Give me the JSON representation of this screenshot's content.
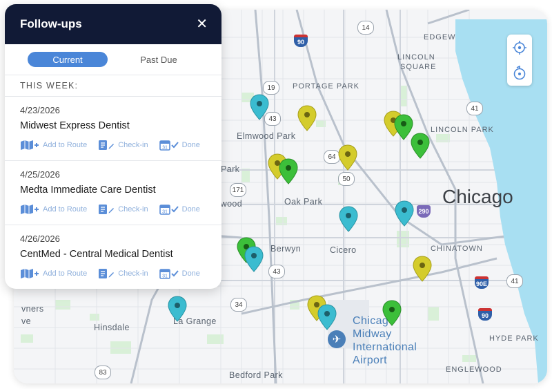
{
  "panel": {
    "title": "Follow-ups",
    "tabs": [
      {
        "label": "Current",
        "active": true
      },
      {
        "label": "Past Due",
        "active": false
      }
    ],
    "section_title": "THIS WEEK:",
    "items": [
      {
        "date": "4/23/2026",
        "name": "Midwest Express Dentist"
      },
      {
        "date": "4/25/2026",
        "name": "Medta Immediate Care Dentist"
      },
      {
        "date": "4/26/2026",
        "name": "CentMed - Central Medical Dentist"
      }
    ],
    "actions": {
      "add_to_route": "Add to Route",
      "check_in": "Check-in",
      "done": "Done"
    }
  },
  "map": {
    "labels": {
      "edgewater": "EDGEW",
      "lincoln_square_1": "LINCOLN",
      "lincoln_square_2": "SQUARE",
      "portage_park": "PORTAGE PARK",
      "elmwood_park": "Elmwood Park",
      "lincoln_park": "LINCOLN PARK",
      "park": "Park",
      "ywood": "ywood",
      "oak_park": "Oak Park",
      "chicago": "Chicago",
      "berwyn": "Berwyn",
      "cicero": "Cicero",
      "chinatown": "CHINATOWN",
      "vners": "vners",
      "ve": "ve",
      "hinsdale": "Hinsdale",
      "la_grange": "La Grange",
      "airport": "Chicago Midway International Airport",
      "hyde_park": "HYDE PARK",
      "englewood": "ENGLEWOOD",
      "bedford_park": "Bedford Park"
    },
    "highways": [
      "14",
      "90",
      "19",
      "43",
      "41",
      "64",
      "50",
      "171",
      "290",
      "43",
      "34",
      "90E",
      "41",
      "90",
      "83"
    ],
    "pin_colors": {
      "teal": "#3bbcd0",
      "yellow": "#d4cc2c",
      "green": "#3cbf3a"
    }
  }
}
